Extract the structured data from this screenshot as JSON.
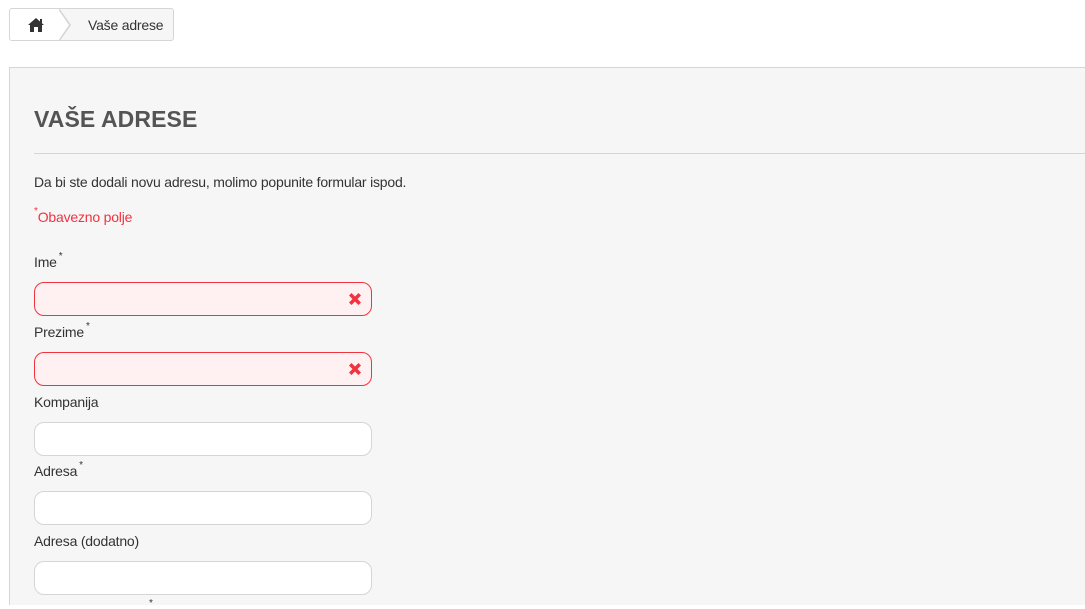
{
  "breadcrumb": {
    "home_icon": "home-icon",
    "current": "Vaše adrese"
  },
  "page": {
    "title": "VAŠE ADRESE",
    "intro": "Da bi ste dodali novu adresu, molimo popunite formular ispod.",
    "required_note": "Obavezno polje",
    "required_mark": "*"
  },
  "form": {
    "fields": [
      {
        "label": "Ime",
        "required": "*",
        "value": "",
        "state": "error"
      },
      {
        "label": "Prezime",
        "required": "*",
        "value": "",
        "state": "error"
      },
      {
        "label": "Kompanija",
        "required": "",
        "value": "",
        "state": "normal"
      },
      {
        "label": "Adresa",
        "required": "*",
        "value": "",
        "state": "normal"
      },
      {
        "label": "Adresa (dodatno)",
        "required": "",
        "value": "",
        "state": "normal"
      }
    ],
    "next_required_mark": "*"
  },
  "colors": {
    "error": "#f13340",
    "error_bg": "#fff1f2",
    "panel_bg": "#f6f6f6",
    "border": "#d6d4d4",
    "title": "#555454"
  },
  "icons": {
    "error": "error-x-icon"
  }
}
